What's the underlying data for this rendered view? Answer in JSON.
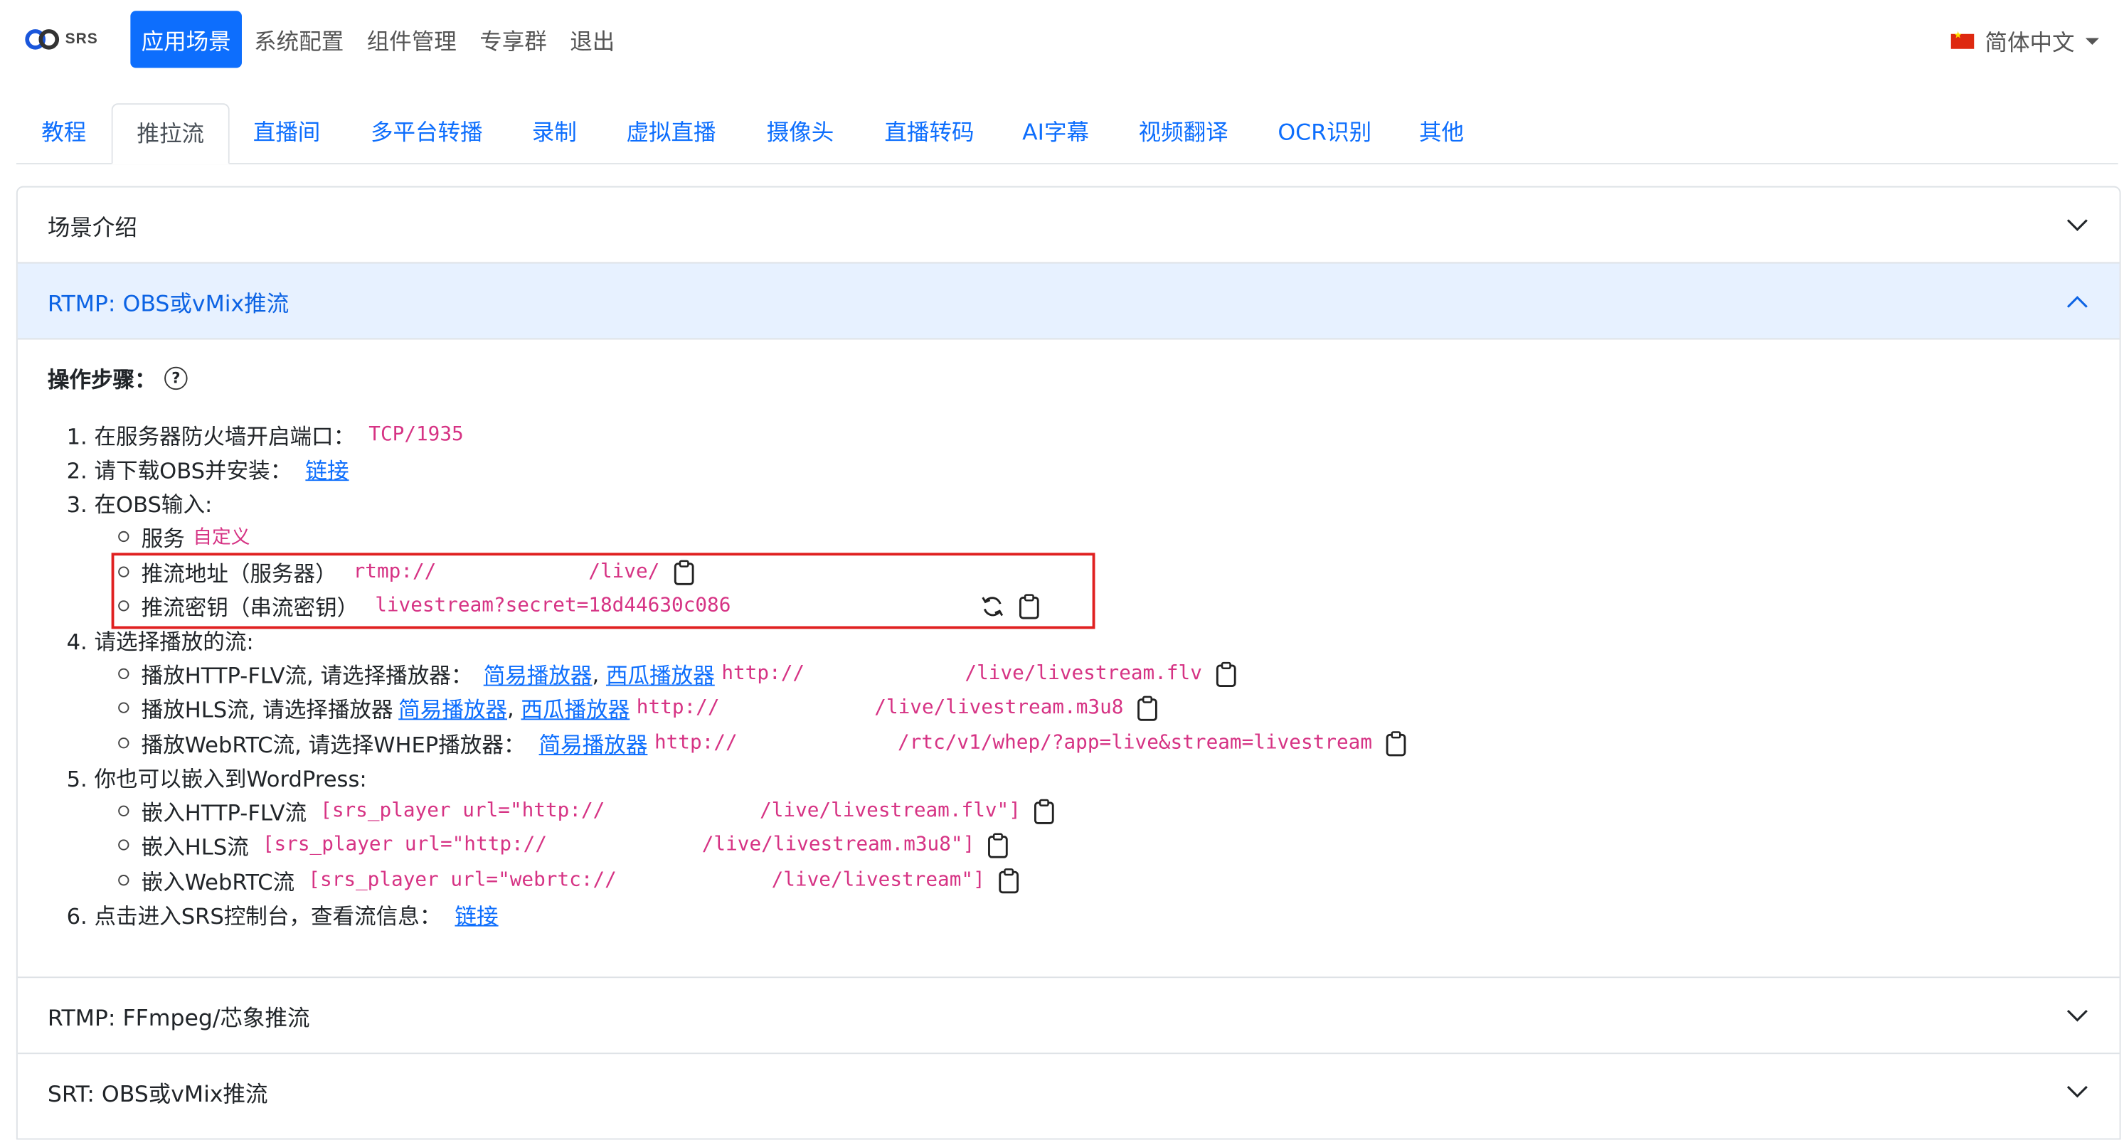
{
  "logo": {
    "text": "SRS"
  },
  "top_nav": [
    "应用场景",
    "系统配置",
    "组件管理",
    "专享群",
    "退出"
  ],
  "language": {
    "label": "简体中文",
    "icon": "china-flag-icon"
  },
  "tabs": [
    "教程",
    "推拉流",
    "直播间",
    "多平台转播",
    "录制",
    "虚拟直播",
    "摄像头",
    "直播转码",
    "AI字幕",
    "视频翻译",
    "OCR识别",
    "其他"
  ],
  "accordion": {
    "intro": "场景介绍",
    "rtmp_obs": "RTMP: OBS或vMix推流",
    "rtmp_ffmpeg": "RTMP: FFmpeg/芯象推流",
    "srt_obs": "SRT: OBS或vMix推流"
  },
  "steps": {
    "title": "操作步骤：",
    "s1": {
      "text": "1. 在服务器防火墙开启端口：",
      "code": "TCP/1935"
    },
    "s2": {
      "text": "2. 请下载OBS并安装：",
      "link": "链接"
    },
    "s3": {
      "text": "3. 在OBS输入:",
      "service_label": "服务",
      "service_value": "自定义",
      "server_label": "推流地址（服务器）",
      "server_prefix": "rtmp://",
      "server_suffix": "/live/",
      "key_label": "推流密钥（串流密钥）",
      "key_value": "livestream?secret=18d44630c086"
    },
    "s4": {
      "text": "4. 请选择播放的流:",
      "flv_label": "播放HTTP-FLV流, 请选择播放器：",
      "hls_label": "播放HLS流, 请选择播放器",
      "webrtc_label": "播放WebRTC流, 请选择WHEP播放器：",
      "player_simple": "简易播放器",
      "player_xigua": "西瓜播放器",
      "flv_prefix": "http://",
      "flv_suffix": "/live/livestream.flv",
      "hls_prefix": "http://",
      "hls_suffix": "/live/livestream.m3u8",
      "whep_prefix": "http://",
      "whep_suffix": "/rtc/v1/whep/?app=live&stream=livestream"
    },
    "s5": {
      "text": "5. 你也可以嵌入到WordPress:",
      "flv_label": "嵌入HTTP-FLV流",
      "hls_label": "嵌入HLS流",
      "webrtc_label": "嵌入WebRTC流",
      "flv_prefix": "[srs_player url=\"http://",
      "flv_suffix": "/live/livestream.flv\"]",
      "hls_prefix": "[srs_player url=\"http://",
      "hls_suffix": "/live/livestream.m3u8\"]",
      "webrtc_prefix": "[srs_player url=\"webrtc://",
      "webrtc_suffix": "/live/livestream\"]"
    },
    "s6": {
      "text": "6. 点击进入SRS控制台，查看流信息：",
      "link": "链接"
    }
  }
}
